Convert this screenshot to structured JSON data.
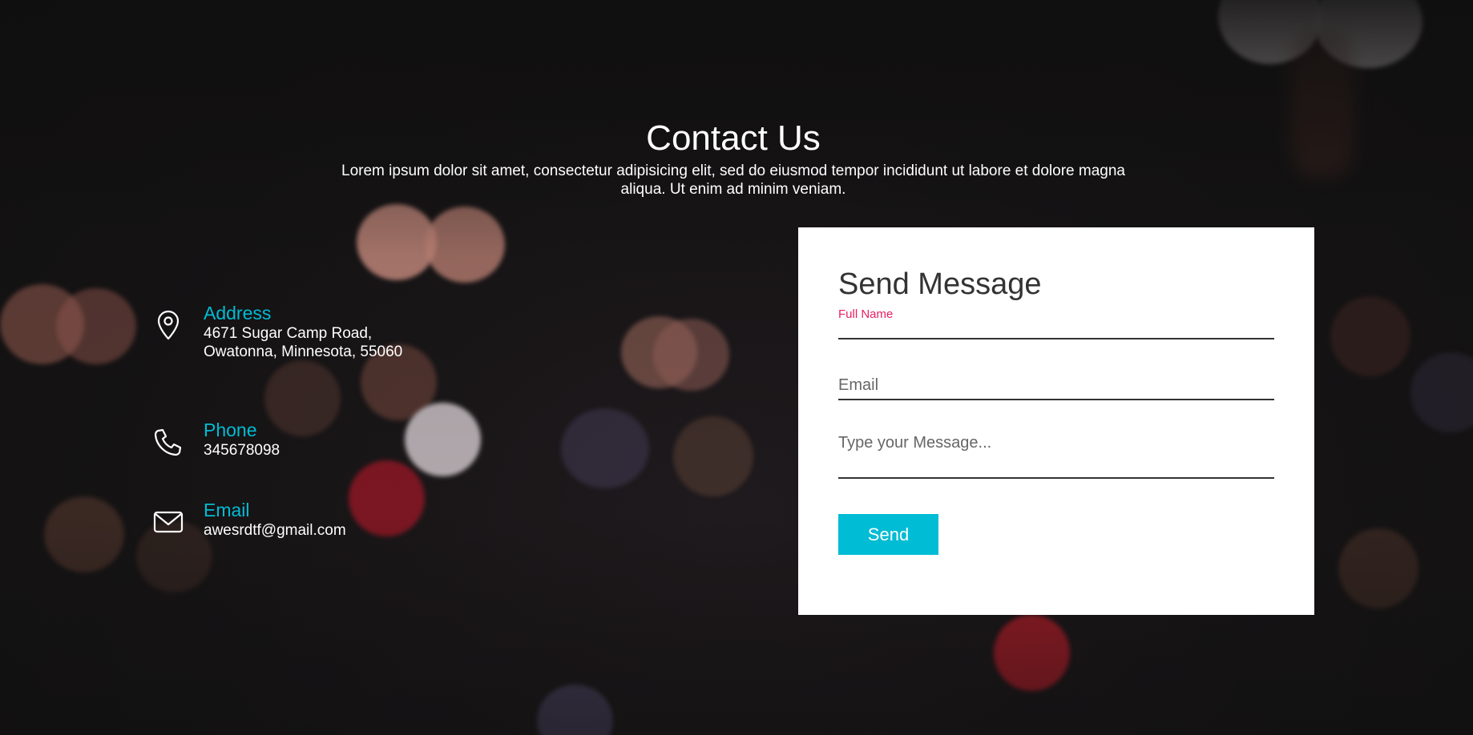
{
  "header": {
    "title": "Contact Us",
    "subtitle": "Lorem ipsum dolor sit amet, consectetur adipisicing elit, sed do eiusmod tempor incididunt ut labore et dolore magna aliqua. Ut enim ad minim veniam."
  },
  "contact_info": {
    "address": {
      "label": "Address",
      "value": "4671 Sugar Camp Road, Owatonna, Minnesota, 55060",
      "icon": "location-pin-icon"
    },
    "phone": {
      "label": "Phone",
      "value": "345678098",
      "icon": "phone-icon"
    },
    "email": {
      "label": "Email",
      "value": "awesrdtf@gmail.com",
      "icon": "envelope-icon"
    }
  },
  "form": {
    "title": "Send Message",
    "full_name_label": "Full Name",
    "email_placeholder": "Email",
    "message_placeholder": "Type your Message...",
    "send_label": "Send"
  },
  "colors": {
    "accent": "#00bcd4",
    "focus_label": "#e91e63",
    "background": "#151414"
  }
}
